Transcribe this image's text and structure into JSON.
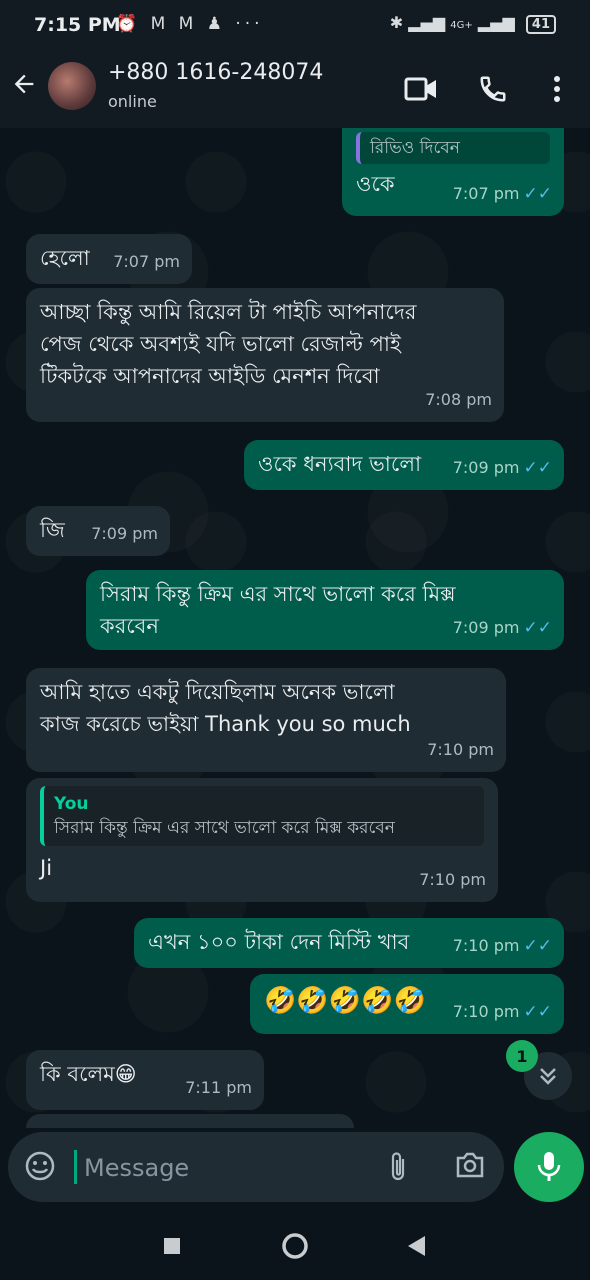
{
  "status_bar": {
    "time": "7:15 PM",
    "notification_icons": [
      "alarm-icon",
      "gmail-icon",
      "gmail-icon",
      "person-icon",
      "more-icon"
    ],
    "network": "4G+",
    "battery": "41"
  },
  "header": {
    "contact_name": "+880 1616-248074",
    "status": "online"
  },
  "messages": [
    {
      "dir": "out",
      "reply_snippet": "রিভিও দিবেন",
      "text": "ওকে",
      "time": "7:07 pm"
    },
    {
      "dir": "in",
      "text": "হেলো",
      "time": "7:07 pm"
    },
    {
      "dir": "in",
      "lines": [
        "আচ্ছা কিন্তু আমি রিয়েল টা পাইচি আপনাদের",
        "পেজ থেকে অবশ্যই যদি ভালো রেজাল্ট পাই",
        "টিকটকে আপনাদের আইডি মেনশন দিবো"
      ],
      "time": "7:08 pm"
    },
    {
      "dir": "out",
      "text": "ওকে ধন্যবাদ ভালো",
      "time": "7:09 pm"
    },
    {
      "dir": "in",
      "text": "জি",
      "time": "7:09 pm"
    },
    {
      "dir": "out",
      "lines": [
        "সিরাম কিন্তু ক্রিম এর সাথে ভালো করে মিক্স",
        "করবেন"
      ],
      "time": "7:09 pm"
    },
    {
      "dir": "in",
      "lines": [
        "আমি হাতে একটু দিয়েছিলাম অনেক ভালো",
        "কাজ করেচে ভাইয়া Thank you so much"
      ],
      "time": "7:10 pm"
    },
    {
      "dir": "in",
      "reply_author": "You",
      "reply_text": "সিরাম কিন্তু ক্রিম এর সাথে ভালো করে মিক্স করবেন",
      "text": "Ji",
      "time": "7:10 pm"
    },
    {
      "dir": "out",
      "text": "এখন ১০০ টাকা দেন মিস্টি খাব",
      "time": "7:10 pm"
    },
    {
      "dir": "out",
      "text": "🤣🤣🤣🤣🤣",
      "time": "7:10 pm"
    },
    {
      "dir": "in",
      "text": "কি বলেম😁",
      "time": "7:11 pm"
    }
  ],
  "scroll_badge": "1",
  "composer": {
    "placeholder": "Message"
  },
  "colors": {
    "accent": "#1aad62",
    "outgoing": "#005c4b",
    "incoming": "#202c33",
    "background": "#0b141a",
    "read_tick": "#53bdeb"
  }
}
